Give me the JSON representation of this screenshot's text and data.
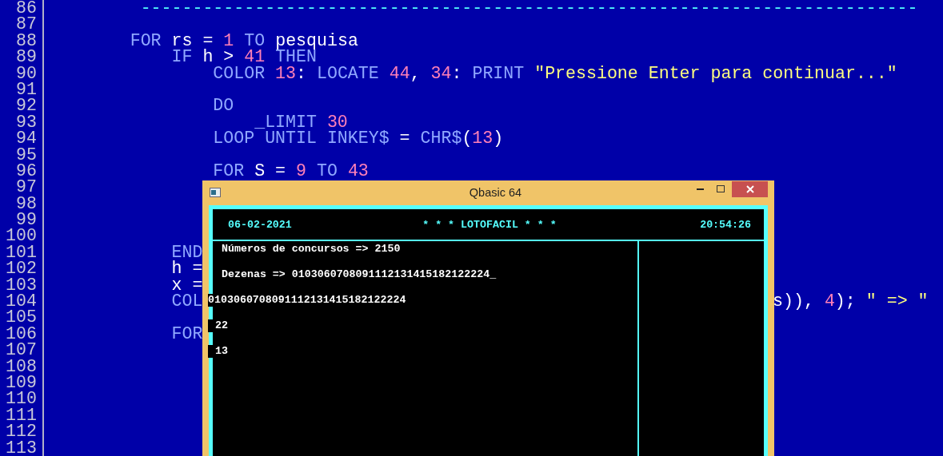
{
  "editor": {
    "lines": [
      {
        "number": "86",
        "code": [
          {
            "text": "         ---------------------------------------------------------------------------",
            "kind": "comment"
          }
        ]
      },
      {
        "number": "87"
      },
      {
        "number": "88",
        "code": [
          {
            "text": "        FOR ",
            "kind": "keyword"
          },
          {
            "text": "rs = ",
            "kind": "ident"
          },
          {
            "text": "1 ",
            "kind": "number"
          },
          {
            "text": "TO ",
            "kind": "keyword"
          },
          {
            "text": "pesquisa",
            "kind": "ident"
          }
        ]
      },
      {
        "number": "89",
        "code": [
          {
            "text": "            IF ",
            "kind": "keyword"
          },
          {
            "text": "h > ",
            "kind": "ident"
          },
          {
            "text": "41 ",
            "kind": "number"
          },
          {
            "text": "THEN",
            "kind": "keyword"
          }
        ]
      },
      {
        "number": "90",
        "code": [
          {
            "text": "                COLOR ",
            "kind": "keyword"
          },
          {
            "text": "13",
            "kind": "number"
          },
          {
            "text": ": ",
            "kind": "ident"
          },
          {
            "text": "LOCATE ",
            "kind": "keyword"
          },
          {
            "text": "44",
            "kind": "number"
          },
          {
            "text": ", ",
            "kind": "ident"
          },
          {
            "text": "34",
            "kind": "number"
          },
          {
            "text": ": ",
            "kind": "ident"
          },
          {
            "text": "PRINT ",
            "kind": "keyword"
          },
          {
            "text": "\"Pressione Enter para continuar...\"",
            "kind": "string"
          }
        ]
      },
      {
        "number": "91"
      },
      {
        "number": "92",
        "code": [
          {
            "text": "                DO",
            "kind": "keyword"
          }
        ]
      },
      {
        "number": "93",
        "code": [
          {
            "text": "                    _LIMIT ",
            "kind": "keyword"
          },
          {
            "text": "30",
            "kind": "number"
          }
        ]
      },
      {
        "number": "94",
        "code": [
          {
            "text": "                LOOP UNTIL INKEY$ ",
            "kind": "keyword"
          },
          {
            "text": "= ",
            "kind": "ident"
          },
          {
            "text": "CHR$",
            "kind": "keyword"
          },
          {
            "text": "(",
            "kind": "ident"
          },
          {
            "text": "13",
            "kind": "number"
          },
          {
            "text": ")",
            "kind": "ident"
          }
        ]
      },
      {
        "number": "95"
      },
      {
        "number": "96",
        "code": [
          {
            "text": "                FOR ",
            "kind": "keyword"
          },
          {
            "text": "S = ",
            "kind": "ident"
          },
          {
            "text": "9 ",
            "kind": "number"
          },
          {
            "text": "TO ",
            "kind": "keyword"
          },
          {
            "text": "43",
            "kind": "number"
          }
        ]
      },
      {
        "number": "97"
      },
      {
        "number": "98"
      },
      {
        "number": "99"
      },
      {
        "number": "100"
      },
      {
        "number": "101",
        "code": [
          {
            "text": "            END",
            "kind": "keyword"
          }
        ]
      },
      {
        "number": "102",
        "code": [
          {
            "text": "            h =",
            "kind": "ident"
          }
        ]
      },
      {
        "number": "103",
        "code": [
          {
            "text": "            x =",
            "kind": "ident"
          }
        ]
      },
      {
        "number": "104",
        "code": [
          {
            "text": "            COL",
            "kind": "keyword"
          }
        ],
        "right": [
          {
            "text": "s)), ",
            "kind": "ident"
          },
          {
            "text": "4",
            "kind": "number"
          },
          {
            "text": "); ",
            "kind": "ident"
          },
          {
            "text": "\" => \"",
            "kind": "string"
          }
        ]
      },
      {
        "number": "105"
      },
      {
        "number": "106",
        "code": [
          {
            "text": "            FOR",
            "kind": "keyword"
          }
        ]
      },
      {
        "number": "107"
      },
      {
        "number": "108"
      },
      {
        "number": "109"
      },
      {
        "number": "110"
      },
      {
        "number": "111"
      },
      {
        "number": "112"
      },
      {
        "number": "113"
      }
    ]
  },
  "window": {
    "title": "Qbasic 64",
    "console": {
      "date": "06-02-2021",
      "heading": "* * * LOTOFACIL * * *",
      "time": "20:54:26",
      "output": [
        {
          "text": "Números de concursos => 2150",
          "kind": "line"
        },
        {
          "text": "Dezenas => 0103060708091112131415182122224_",
          "kind": "line"
        },
        {
          "text": "0103060708091112131415182122224",
          "kind": "raw"
        },
        {
          "text": "22",
          "kind": "value"
        },
        {
          "text": "13",
          "kind": "value"
        }
      ]
    }
  }
}
